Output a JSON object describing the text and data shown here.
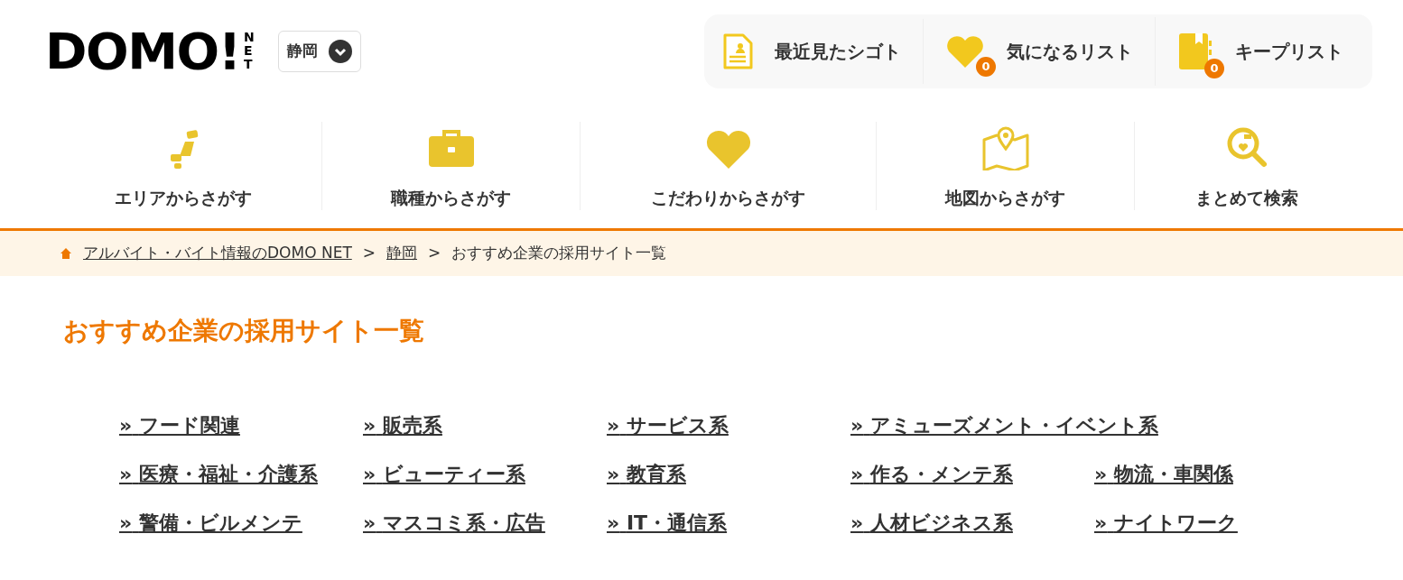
{
  "header": {
    "logo": {
      "main": "DOMO!",
      "sub": "NET"
    },
    "region_select": {
      "value": "静岡"
    },
    "quick_links": [
      {
        "kind": "history",
        "label": "最近見たシゴト"
      },
      {
        "kind": "favorites",
        "label": "気になるリスト",
        "count": "0"
      },
      {
        "kind": "keep",
        "label": "キープリスト",
        "count": "0"
      }
    ]
  },
  "nav": [
    {
      "kind": "area",
      "label": "エリアからさがす"
    },
    {
      "kind": "job",
      "label": "職種からさがす"
    },
    {
      "kind": "feature",
      "label": "こだわりからさがす"
    },
    {
      "kind": "map",
      "label": "地図からさがす"
    },
    {
      "kind": "bulk",
      "label": "まとめて検索"
    }
  ],
  "breadcrumb": [
    {
      "label": "アルバイト・バイト情報のDOMO NET",
      "link": true
    },
    {
      "separator": ">",
      "label": "静岡",
      "link": true
    },
    {
      "separator": ">",
      "label": "おすすめ企業の採用サイト一覧",
      "link": false
    }
  ],
  "page_title": "おすすめ企業の採用サイト一覧",
  "categories": [
    [
      {
        "marker": "»",
        "label": "フード関連"
      },
      {
        "marker": "»",
        "label": "販売系"
      },
      {
        "marker": "»",
        "label": "サービス系"
      },
      {
        "marker": "»",
        "label": "アミューズメント・イベント系"
      }
    ],
    [
      {
        "marker": "»",
        "label": "医療・福祉・介護系"
      },
      {
        "marker": "»",
        "label": "ビューティー系"
      },
      {
        "marker": "»",
        "label": "教育系"
      },
      {
        "marker": "»",
        "label": "作る・メンテ系"
      },
      {
        "marker": "»",
        "label": "物流・車関係"
      }
    ],
    [
      {
        "marker": "»",
        "label": "警備・ビルメンテ"
      },
      {
        "marker": "»",
        "label": "マスコミ系・広告"
      },
      {
        "marker": "»",
        "label": "IT・通信系"
      },
      {
        "marker": "»",
        "label": "人材ビジネス系"
      },
      {
        "marker": "»",
        "label": "ナイトワーク"
      }
    ]
  ]
}
